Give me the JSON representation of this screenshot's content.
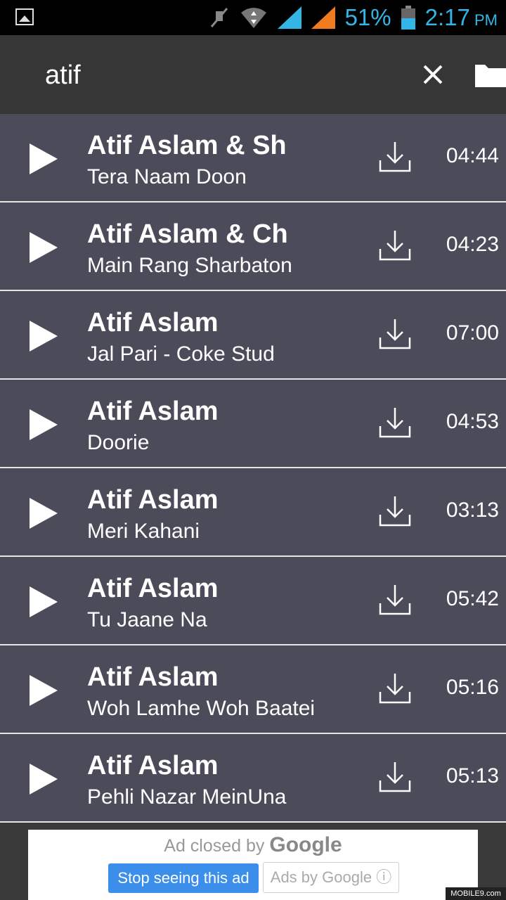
{
  "status_bar": {
    "battery_percent": "51%",
    "time": "2:17",
    "ampm": "PM",
    "icons": [
      "image-notification-icon",
      "mute-icon",
      "wifi-icon",
      "signal-icon",
      "signal-icon",
      "battery-icon"
    ]
  },
  "search": {
    "query": "atif"
  },
  "songs": [
    {
      "artist": "Atif Aslam & Sh",
      "title": "Tera Naam Doon",
      "duration": "04:44"
    },
    {
      "artist": "Atif Aslam & Ch",
      "title": "Main Rang Sharbaton",
      "duration": "04:23"
    },
    {
      "artist": "Atif Aslam",
      "title": "Jal Pari - Coke Stud",
      "duration": "07:00"
    },
    {
      "artist": "Atif Aslam",
      "title": "Doorie",
      "duration": "04:53"
    },
    {
      "artist": "Atif Aslam",
      "title": "Meri Kahani",
      "duration": "03:13"
    },
    {
      "artist": "Atif Aslam",
      "title": "Tu Jaane Na",
      "duration": "05:42"
    },
    {
      "artist": "Atif Aslam",
      "title": "Woh Lamhe Woh Baatei",
      "duration": "05:16"
    },
    {
      "artist": "Atif Aslam",
      "title": "Pehli Nazar MeinUna",
      "duration": "05:13"
    }
  ],
  "ad": {
    "closed_prefix": "Ad closed by",
    "closed_brand": "Google",
    "stop_label": "Stop seeing this ad",
    "adsby_label": "Ads by Google",
    "info_glyph": "ⓘ"
  },
  "watermark": "MOBILE9.com",
  "colors": {
    "list_bg": "#4b4b5a",
    "toolbar_bg": "#363636",
    "status_accent": "#33b5e5",
    "stop_button": "#3b8eea"
  }
}
